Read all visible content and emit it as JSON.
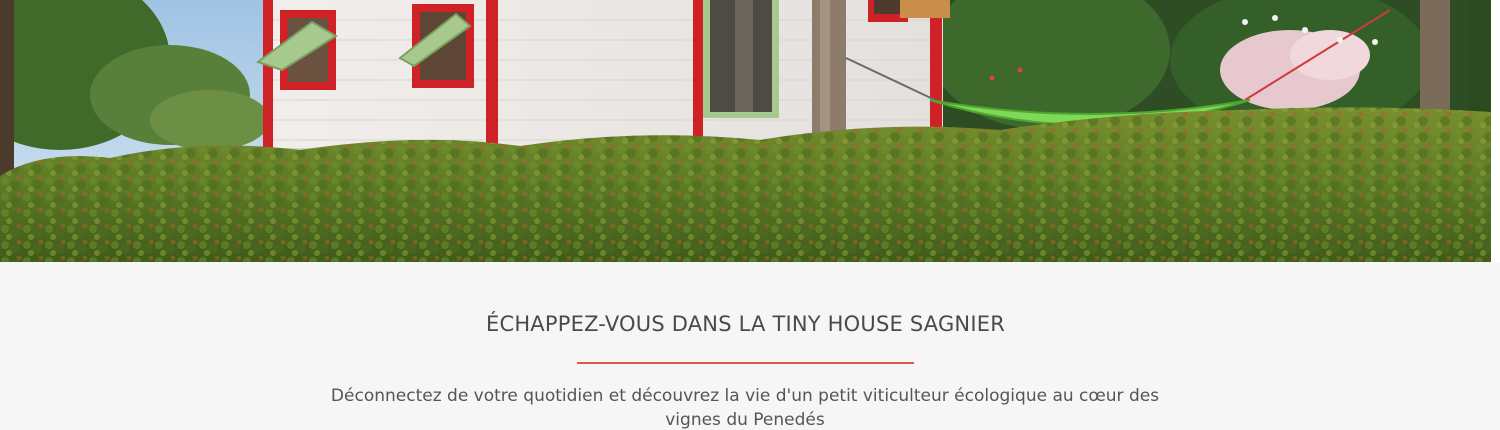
{
  "hero": {
    "scene": "tiny-house-hedge-garden",
    "colors": {
      "sky": "#b9d4ea",
      "house_wall": "#f3f0ee",
      "house_trim": "#cf2227",
      "window_frame": "#a8c98e",
      "hedge": "#5f7f2a",
      "hammock": "#7ed957",
      "tree_trunk": "#8d7c6a"
    }
  },
  "section": {
    "title": "ÉCHAPPEZ-VOUS DANS LA TINY HOUSE SAGNIER",
    "rule_color": "#e0584c",
    "text": "Déconnectez de votre quotidien et découvrez la vie d'un petit viticulteur écologique au cœur des vignes du Penedés"
  }
}
